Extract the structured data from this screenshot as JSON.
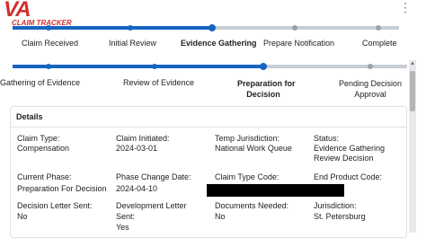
{
  "app": {
    "logo_main": "VA",
    "logo_sub": "CLAIM TRACKER",
    "menu_icon": "vertical-ellipsis-icon"
  },
  "colors": {
    "brand_red": "#d32f2f",
    "accent_blue": "#1565c0",
    "pending_grey": "#c7cdd4"
  },
  "claim_progress": {
    "steps": [
      {
        "label": "Claim Received",
        "state": "complete"
      },
      {
        "label": "Initial Review",
        "state": "complete"
      },
      {
        "label": "Evidence Gathering",
        "state": "current"
      },
      {
        "label": "Prepare Notification",
        "state": "pending"
      },
      {
        "label": "Complete",
        "state": "pending"
      }
    ]
  },
  "phase_progress": {
    "steps": [
      {
        "label": "Gathering of Evidence",
        "state": "complete"
      },
      {
        "label": "Review of Evidence",
        "state": "complete"
      },
      {
        "label_line1": "Preparation for",
        "label_line2": "Decision",
        "state": "current"
      },
      {
        "label_line1": "Pending Decision",
        "label_line2": "Approval",
        "state": "pending"
      }
    ]
  },
  "details": {
    "title": "Details",
    "claim_type": {
      "label": "Claim Type:",
      "value": "Compensation"
    },
    "claim_initiated": {
      "label": "Claim Initiated:",
      "value": "2024-03-01"
    },
    "temp_jurisdiction": {
      "label": "Temp Jurisdiction:",
      "value": "National Work Queue"
    },
    "status": {
      "label": "Status:",
      "value_line1": "Evidence Gathering",
      "value_line2": "Review Decision"
    },
    "current_phase": {
      "label": "Current Phase:",
      "value": "Preparation For Decision"
    },
    "phase_change_date": {
      "label": "Phase Change Date:",
      "value": "2024-04-10"
    },
    "claim_type_code": {
      "label": "Claim Type Code:"
    },
    "end_product_code": {
      "label": "End Product Code:"
    },
    "decision_letter_sent": {
      "label": "Decision Letter Sent:",
      "value": "No"
    },
    "development_letter_sent": {
      "label_line1": "Development Letter",
      "label_line2": "Sent:",
      "value": "Yes"
    },
    "documents_needed": {
      "label": "Documents Needed:",
      "value": "No"
    },
    "jurisdiction": {
      "label": "Jurisdiction:",
      "value": "St. Petersburg"
    }
  }
}
